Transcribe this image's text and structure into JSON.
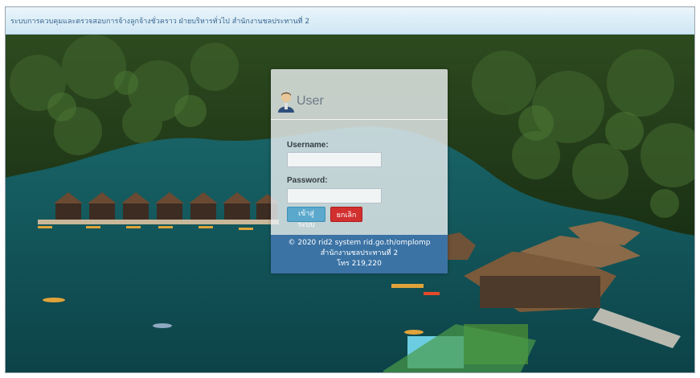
{
  "header": {
    "title": "ระบบการควบคุมและตรวจสอบการจ้างลูกจ้างชั่วคราว ฝ่ายบริหารทั่วไป สำนักงานชลประทานที่ 2"
  },
  "login": {
    "title": "User",
    "username_label": "Username:",
    "username_value": "",
    "password_label": "Password:",
    "password_value": "",
    "login_button": "เข้าสู่ระบบ",
    "cancel_button": "ยกเลิก",
    "footer": {
      "line1": "© 2020 rid2 system rid.go.th/omplomp",
      "line2": "สำนักงานชลประทานที่ 2",
      "line3": "โทร 219,220"
    }
  },
  "icons": {
    "user": "user-icon"
  },
  "colors": {
    "header_bg": "#d6ebf6",
    "header_text": "#37658f",
    "login_button": "#5aa8cc",
    "cancel_button": "#d22f2f",
    "footer_bg": "#2c68a0"
  }
}
